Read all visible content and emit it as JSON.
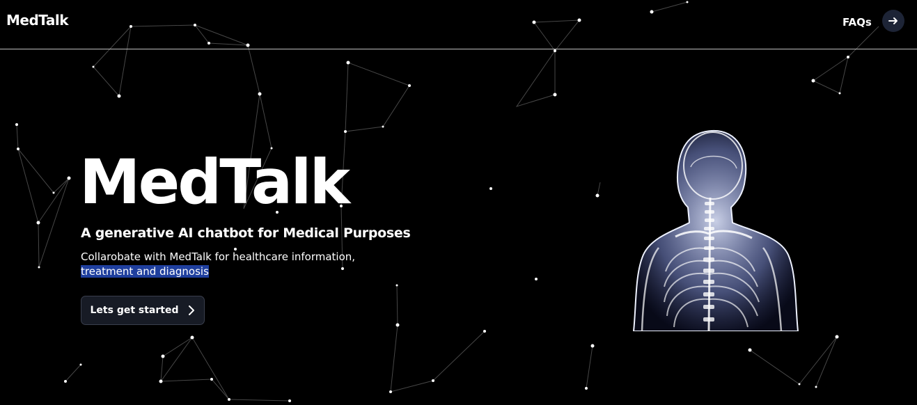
{
  "header": {
    "brand": "MedTalk",
    "faqs_label": "FAQs",
    "arrow_icon": "arrow-right-icon"
  },
  "hero": {
    "title": "MedTalk",
    "subtitle": "A generative AI chatbot for Medical Purposes",
    "description_line1": "Collarobate with MedTalk for healthcare information,",
    "description_highlight": "treatment and diagnosis",
    "cta_label": "Lets get started",
    "cta_icon": "chevron-right-icon"
  },
  "illustration": {
    "name": "xray-human-torso"
  },
  "colors": {
    "background": "#000000",
    "text": "#ffffff",
    "highlight": "#1f3f9e",
    "button_bg": "#171b25",
    "xray_glow": "#c8d2ff"
  }
}
